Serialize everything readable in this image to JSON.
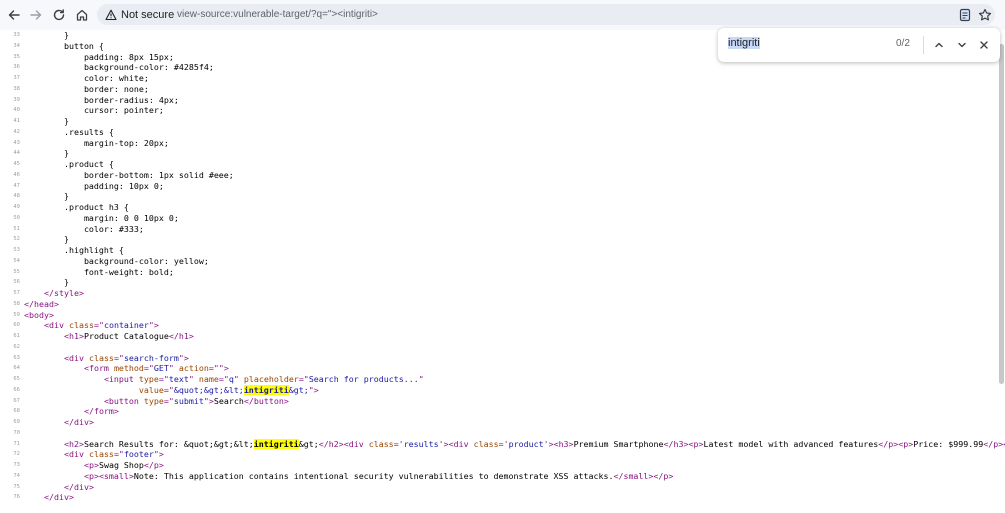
{
  "browser": {
    "security_label": "Not secure",
    "url": "view-source:vulnerable-target/?q=\"><intigriti>"
  },
  "find_bar": {
    "query": "intigriti",
    "count": "0/2"
  },
  "source_lines": [
    {
      "n": "33",
      "t": [
        {
          "x": "        }"
        }
      ]
    },
    {
      "n": "34",
      "t": [
        {
          "x": "        button {"
        }
      ]
    },
    {
      "n": "35",
      "t": [
        {
          "x": "            padding: 8px 15px;"
        }
      ]
    },
    {
      "n": "36",
      "t": [
        {
          "x": "            background-color: #4285f4;"
        }
      ]
    },
    {
      "n": "37",
      "t": [
        {
          "x": "            color: white;"
        }
      ]
    },
    {
      "n": "38",
      "t": [
        {
          "x": "            border: none;"
        }
      ]
    },
    {
      "n": "39",
      "t": [
        {
          "x": "            border-radius: 4px;"
        }
      ]
    },
    {
      "n": "40",
      "t": [
        {
          "x": "            cursor: pointer;"
        }
      ]
    },
    {
      "n": "41",
      "t": [
        {
          "x": "        }"
        }
      ]
    },
    {
      "n": "42",
      "t": [
        {
          "x": "        .results {"
        }
      ]
    },
    {
      "n": "43",
      "t": [
        {
          "x": "            margin-top: 20px;"
        }
      ]
    },
    {
      "n": "44",
      "t": [
        {
          "x": "        }"
        }
      ]
    },
    {
      "n": "45",
      "t": [
        {
          "x": "        .product {"
        }
      ]
    },
    {
      "n": "46",
      "t": [
        {
          "x": "            border-bottom: 1px solid #eee;"
        }
      ]
    },
    {
      "n": "47",
      "t": [
        {
          "x": "            padding: 10px 0;"
        }
      ]
    },
    {
      "n": "48",
      "t": [
        {
          "x": "        }"
        }
      ]
    },
    {
      "n": "49",
      "t": [
        {
          "x": "        .product h3 {"
        }
      ]
    },
    {
      "n": "50",
      "t": [
        {
          "x": "            margin: 0 0 10px 0;"
        }
      ]
    },
    {
      "n": "51",
      "t": [
        {
          "x": "            color: #333;"
        }
      ]
    },
    {
      "n": "52",
      "t": [
        {
          "x": "        }"
        }
      ]
    },
    {
      "n": "53",
      "t": [
        {
          "x": "        .highlight {"
        }
      ]
    },
    {
      "n": "54",
      "t": [
        {
          "x": "            background-color: yellow;"
        }
      ]
    },
    {
      "n": "55",
      "t": [
        {
          "x": "            font-weight: bold;"
        }
      ]
    },
    {
      "n": "56",
      "t": [
        {
          "x": "        }"
        }
      ]
    },
    {
      "n": "57",
      "t": [
        {
          "x": "    "
        },
        {
          "x": "</style>",
          "c": "tag"
        }
      ]
    },
    {
      "n": "58",
      "t": [
        {
          "x": "</head>",
          "c": "tag"
        }
      ]
    },
    {
      "n": "59",
      "t": [
        {
          "x": "<body>",
          "c": "tag"
        }
      ]
    },
    {
      "n": "60",
      "t": [
        {
          "x": "    "
        },
        {
          "x": "<div ",
          "c": "tag"
        },
        {
          "x": "class",
          "c": "an"
        },
        {
          "x": "=\"",
          "c": "tag"
        },
        {
          "x": "container",
          "c": "av"
        },
        {
          "x": "\">",
          "c": "tag"
        }
      ]
    },
    {
      "n": "61",
      "t": [
        {
          "x": "        "
        },
        {
          "x": "<h1>",
          "c": "tag"
        },
        {
          "x": "Product Catalogue"
        },
        {
          "x": "</h1>",
          "c": "tag"
        }
      ]
    },
    {
      "n": "62",
      "t": [
        {
          "x": ""
        }
      ]
    },
    {
      "n": "63",
      "t": [
        {
          "x": "        "
        },
        {
          "x": "<div ",
          "c": "tag"
        },
        {
          "x": "class",
          "c": "an"
        },
        {
          "x": "=\"",
          "c": "tag"
        },
        {
          "x": "search-form",
          "c": "av"
        },
        {
          "x": "\">",
          "c": "tag"
        }
      ]
    },
    {
      "n": "64",
      "t": [
        {
          "x": "            "
        },
        {
          "x": "<form ",
          "c": "tag"
        },
        {
          "x": "method",
          "c": "an"
        },
        {
          "x": "=\"",
          "c": "tag"
        },
        {
          "x": "GET",
          "c": "av"
        },
        {
          "x": "\" ",
          "c": "tag"
        },
        {
          "x": "action",
          "c": "an"
        },
        {
          "x": "=\"",
          "c": "tag"
        },
        {
          "x": "\">",
          "c": "tag"
        }
      ]
    },
    {
      "n": "65",
      "t": [
        {
          "x": "                "
        },
        {
          "x": "<input ",
          "c": "tag"
        },
        {
          "x": "type",
          "c": "an"
        },
        {
          "x": "=\"",
          "c": "tag"
        },
        {
          "x": "text",
          "c": "av"
        },
        {
          "x": "\" ",
          "c": "tag"
        },
        {
          "x": "name",
          "c": "an"
        },
        {
          "x": "=\"",
          "c": "tag"
        },
        {
          "x": "q",
          "c": "av"
        },
        {
          "x": "\" ",
          "c": "tag"
        },
        {
          "x": "placeholder",
          "c": "an"
        },
        {
          "x": "=\"",
          "c": "tag"
        },
        {
          "x": "Search for products...",
          "c": "av"
        },
        {
          "x": "\"",
          "c": "tag"
        }
      ]
    },
    {
      "n": "66",
      "t": [
        {
          "x": "                       "
        },
        {
          "x": "value",
          "c": "an"
        },
        {
          "x": "=\"",
          "c": "tag"
        },
        {
          "x": "&quot;&gt;&lt;",
          "c": "av"
        },
        {
          "x": "intigriti",
          "c": "av hl"
        },
        {
          "x": "&gt;",
          "c": "av"
        },
        {
          "x": "\">",
          "c": "tag"
        }
      ]
    },
    {
      "n": "67",
      "t": [
        {
          "x": "                "
        },
        {
          "x": "<button ",
          "c": "tag"
        },
        {
          "x": "type",
          "c": "an"
        },
        {
          "x": "=\"",
          "c": "tag"
        },
        {
          "x": "submit",
          "c": "av"
        },
        {
          "x": "\">",
          "c": "tag"
        },
        {
          "x": "Search"
        },
        {
          "x": "</button>",
          "c": "tag"
        }
      ]
    },
    {
      "n": "68",
      "t": [
        {
          "x": "            "
        },
        {
          "x": "</form>",
          "c": "tag"
        }
      ]
    },
    {
      "n": "69",
      "t": [
        {
          "x": "        "
        },
        {
          "x": "</div>",
          "c": "tag"
        }
      ]
    },
    {
      "n": "70",
      "t": [
        {
          "x": ""
        }
      ]
    },
    {
      "n": "71",
      "t": [
        {
          "x": "        "
        },
        {
          "x": "<h2>",
          "c": "tag"
        },
        {
          "x": "Search Results for: &quot;&gt;&lt;"
        },
        {
          "x": "intigriti",
          "c": "hl"
        },
        {
          "x": "&gt;"
        },
        {
          "x": "</h2><div ",
          "c": "tag"
        },
        {
          "x": "class",
          "c": "an"
        },
        {
          "x": "='",
          "c": "tag"
        },
        {
          "x": "results",
          "c": "av"
        },
        {
          "x": "'><div ",
          "c": "tag"
        },
        {
          "x": "class",
          "c": "an"
        },
        {
          "x": "='",
          "c": "tag"
        },
        {
          "x": "product",
          "c": "av"
        },
        {
          "x": "'><h3>",
          "c": "tag"
        },
        {
          "x": "Premium Smartphone"
        },
        {
          "x": "</h3><p>",
          "c": "tag"
        },
        {
          "x": "Latest model with advanced features"
        },
        {
          "x": "</p><p>",
          "c": "tag"
        },
        {
          "x": "Price: $999.99"
        },
        {
          "x": "</p></d",
          "c": "tag"
        }
      ]
    },
    {
      "n": "72",
      "t": [
        {
          "x": "        "
        },
        {
          "x": "<div ",
          "c": "tag"
        },
        {
          "x": "class",
          "c": "an"
        },
        {
          "x": "=\"",
          "c": "tag"
        },
        {
          "x": "footer",
          "c": "av"
        },
        {
          "x": "\">",
          "c": "tag"
        }
      ]
    },
    {
      "n": "73",
      "t": [
        {
          "x": "            "
        },
        {
          "x": "<p>",
          "c": "tag"
        },
        {
          "x": "Swag Shop"
        },
        {
          "x": "</p>",
          "c": "tag"
        }
      ]
    },
    {
      "n": "74",
      "t": [
        {
          "x": "            "
        },
        {
          "x": "<p><small>",
          "c": "tag"
        },
        {
          "x": "Note: This application contains intentional security vulnerabilities to demonstrate XSS attacks."
        },
        {
          "x": "</small></p>",
          "c": "tag"
        }
      ]
    },
    {
      "n": "75",
      "t": [
        {
          "x": "        "
        },
        {
          "x": "</div>",
          "c": "tag"
        }
      ]
    },
    {
      "n": "76",
      "t": [
        {
          "x": "    "
        },
        {
          "x": "</div>",
          "c": "tag"
        }
      ]
    }
  ]
}
